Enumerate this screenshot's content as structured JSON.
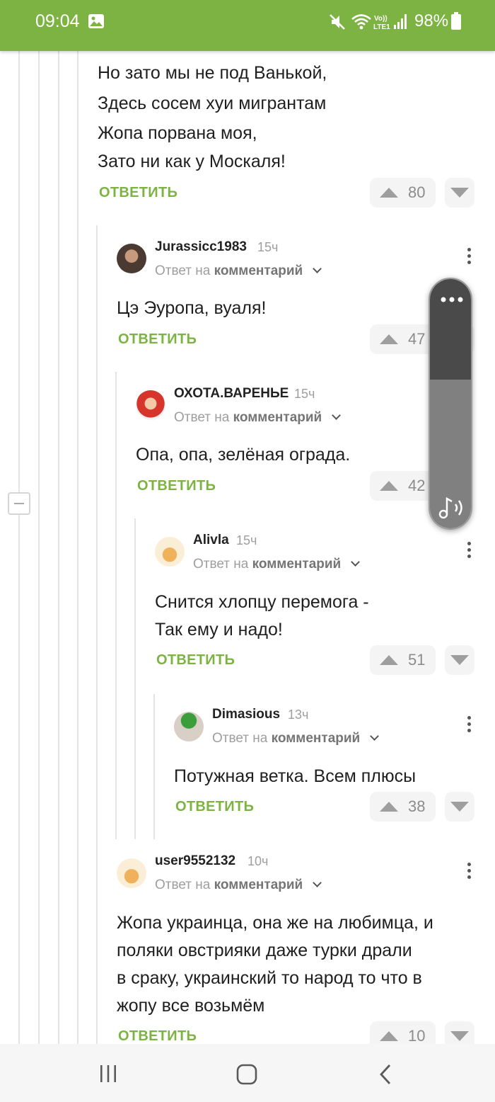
{
  "status_bar": {
    "time": "09:04",
    "battery": "98%"
  },
  "colors": {
    "brand_green": "#7cb342",
    "status_bar": "#7cb342"
  },
  "top_comment": {
    "lines": [
      "Но зато мы не под Ванькой,",
      "Здесь сосем хуи мигрантам",
      "Жопа порвана моя,",
      "Зато ни как у Москаля!"
    ],
    "reply_label": "ОТВЕТИТЬ",
    "score": "80"
  },
  "comments": [
    {
      "author": "Jurassicc1983",
      "time": "15ч",
      "answer_prefix": "Ответ на",
      "answer_target": "комментарий",
      "lines": [
        "Цэ Эуропа, вуаля!"
      ],
      "reply_label": "ОТВЕТИТЬ",
      "score": "47"
    },
    {
      "author": "ОХОТА.ВАРЕНЬЕ",
      "time": "15ч",
      "answer_prefix": "Ответ на",
      "answer_target": "комментарий",
      "lines": [
        "Опа, опа, зелёная ограда."
      ],
      "reply_label": "ОТВЕТИТЬ",
      "score": "42"
    },
    {
      "author": "Alivla",
      "time": "15ч",
      "answer_prefix": "Ответ на",
      "answer_target": "комментарий",
      "lines": [
        "Снится хлопцу перемога -",
        "Так ему и надо!"
      ],
      "reply_label": "ОТВЕТИТЬ",
      "score": "51"
    },
    {
      "author": "Dimasious",
      "time": "13ч",
      "answer_prefix": "Ответ на",
      "answer_target": "комментарий",
      "lines": [
        "Потужная ветка. Всем плюсы"
      ],
      "reply_label": "ОТВЕТИТЬ",
      "score": "38"
    },
    {
      "author": "user9552132",
      "time": "10ч",
      "answer_prefix": "Ответ на",
      "answer_target": "комментарий",
      "lines": [
        "Жопа украинца, она же на любимца, и",
        "поляки овстрияки даже турки драли",
        "в сраку, украинский то народ то что в",
        "жопу все возьмём"
      ],
      "reply_label": "ОТВЕТИТЬ",
      "score": "10"
    }
  ],
  "icons": {
    "status": [
      "image-icon",
      "mute-icon",
      "wifi-icon",
      "volte-icon",
      "signal-icon",
      "battery-icon"
    ],
    "comment": [
      "upvote-icon",
      "downvote-icon",
      "more-icon",
      "chevron-down-icon"
    ],
    "volume_panel": [
      "more-icon",
      "music-volume-icon"
    ],
    "navigation": [
      "recent-apps-icon",
      "home-icon",
      "back-icon"
    ]
  }
}
